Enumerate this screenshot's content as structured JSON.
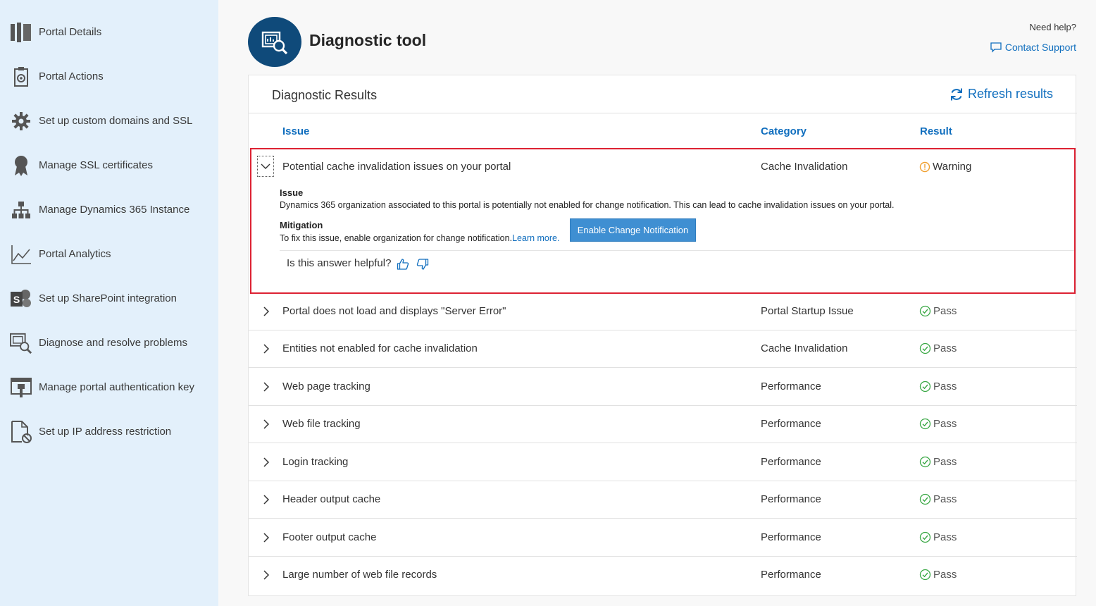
{
  "sidebar": {
    "items": [
      {
        "label": "Portal Details",
        "icon": "portal-details-icon"
      },
      {
        "label": "Portal Actions",
        "icon": "portal-actions-icon"
      },
      {
        "label": "Set up custom domains and SSL",
        "icon": "gear-icon"
      },
      {
        "label": "Manage SSL certificates",
        "icon": "certificate-icon"
      },
      {
        "label": "Manage Dynamics 365 Instance",
        "icon": "hierarchy-icon"
      },
      {
        "label": "Portal Analytics",
        "icon": "line-chart-icon"
      },
      {
        "label": "Set up SharePoint integration",
        "icon": "sharepoint-icon"
      },
      {
        "label": "Diagnose and resolve problems",
        "icon": "diagnose-icon"
      },
      {
        "label": "Manage portal authentication key",
        "icon": "auth-key-icon"
      },
      {
        "label": "Set up IP address restriction",
        "icon": "ip-restriction-icon"
      }
    ]
  },
  "header": {
    "title": "Diagnostic tool",
    "need_help": "Need help?",
    "contact_support": "Contact Support"
  },
  "results": {
    "title": "Diagnostic Results",
    "refresh": "Refresh results",
    "columns": {
      "issue": "Issue",
      "category": "Category",
      "result": "Result"
    },
    "expanded": {
      "issue": "Potential cache invalidation issues on your portal",
      "category": "Cache Invalidation",
      "result": "Warning",
      "issue_heading": "Issue",
      "issue_text": "Dynamics 365 organization associated to this portal is potentially not enabled for change notification. This can lead to cache invalidation issues on your portal.",
      "mitigation_heading": "Mitigation",
      "mitigation_text": "To fix this issue, enable organization for change notification.",
      "learn_more": "Learn more.",
      "button": "Enable Change Notification",
      "helpful": "Is this answer helpful?"
    },
    "rows": [
      {
        "issue": "Portal does not load and displays \"Server Error\"",
        "category": "Portal Startup Issue",
        "result": "Pass"
      },
      {
        "issue": "Entities not enabled for cache invalidation",
        "category": "Cache Invalidation",
        "result": "Pass"
      },
      {
        "issue": "Web page tracking",
        "category": "Performance",
        "result": "Pass"
      },
      {
        "issue": "Web file tracking",
        "category": "Performance",
        "result": "Pass"
      },
      {
        "issue": "Login tracking",
        "category": "Performance",
        "result": "Pass"
      },
      {
        "issue": "Header output cache",
        "category": "Performance",
        "result": "Pass"
      },
      {
        "issue": "Footer output cache",
        "category": "Performance",
        "result": "Pass"
      },
      {
        "issue": "Large number of web file records",
        "category": "Performance",
        "result": "Pass"
      }
    ]
  },
  "colors": {
    "accent": "#106ebe",
    "sidebar_bg": "#e3f0fb",
    "logo_bg": "#0f4a7a",
    "highlight_border": "#dd2233",
    "warning": "#f0a030",
    "pass": "#3aa845"
  }
}
